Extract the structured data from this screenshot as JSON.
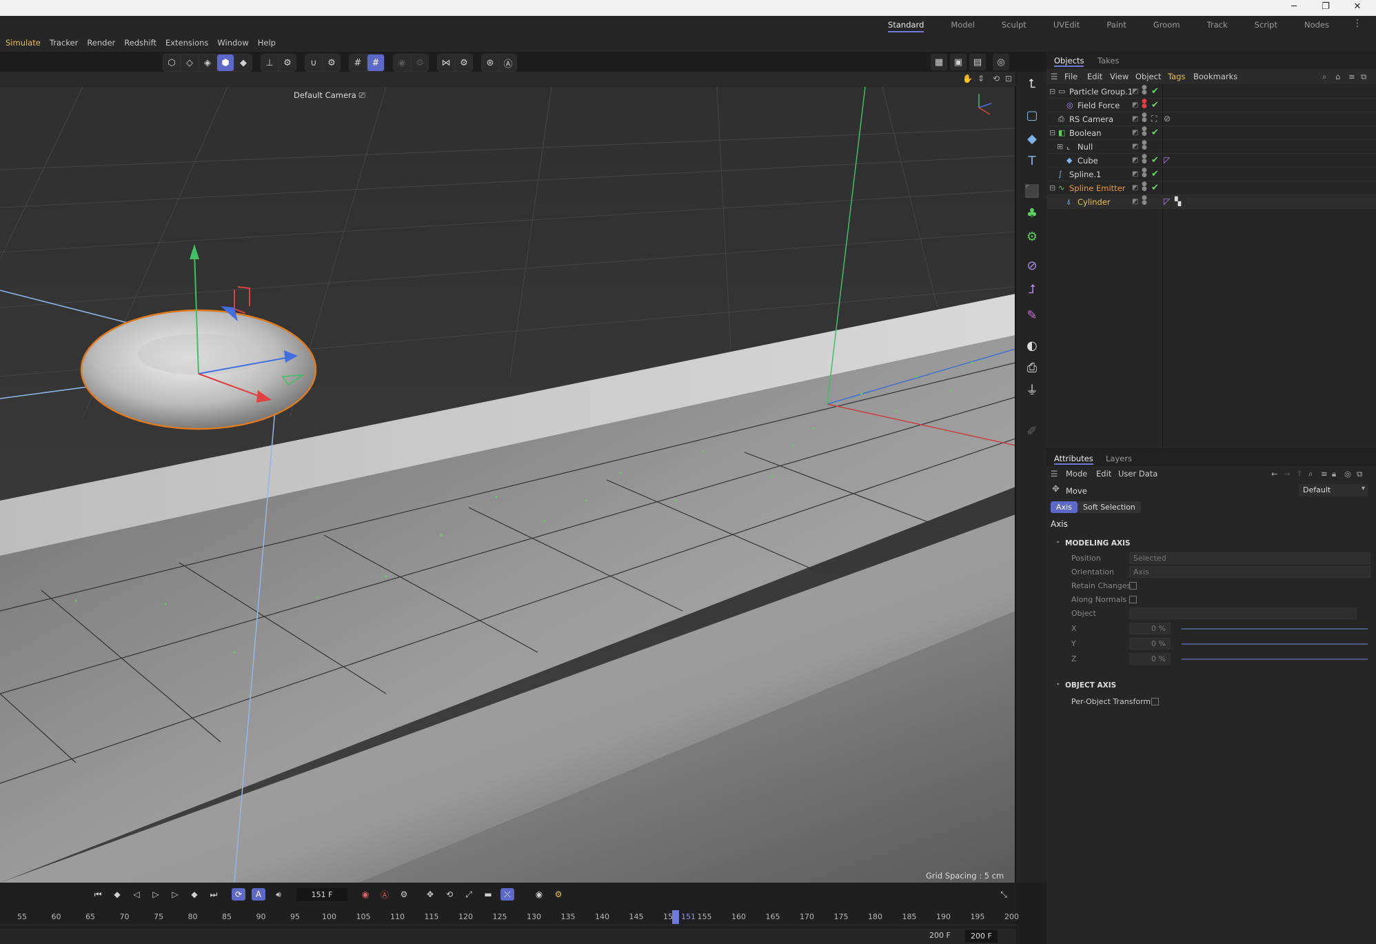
{
  "window": {
    "minimize": "─",
    "restore": "❐",
    "close": "✕"
  },
  "menus": [
    "Simulate",
    "Tracker",
    "Render",
    "Redshift",
    "Extensions",
    "Window",
    "Help"
  ],
  "layouts": [
    "Standard",
    "Model",
    "Sculpt",
    "UVEdit",
    "Paint",
    "Groom",
    "Track",
    "Script",
    "Nodes"
  ],
  "viewport": {
    "camera_label": "Default Camera",
    "grid_info": "Grid Spacing : 5 cm"
  },
  "objects_panel": {
    "tabs": [
      "Objects",
      "Takes"
    ],
    "menu": [
      "File",
      "Edit",
      "View",
      "Object",
      "Tags",
      "Bookmarks"
    ],
    "rows": [
      {
        "name": "Particle Group.1",
        "indent": 0,
        "icon": "folder-icon"
      },
      {
        "name": "Field Force",
        "indent": 1,
        "icon": "field-force-icon"
      },
      {
        "name": "RS Camera",
        "indent": 0,
        "icon": "camera-icon"
      },
      {
        "name": "Boolean",
        "indent": 0,
        "icon": "boolean-icon"
      },
      {
        "name": "Null",
        "indent": 1,
        "icon": "null-icon"
      },
      {
        "name": "Cube",
        "indent": 1,
        "icon": "cube-icon"
      },
      {
        "name": "Spline.1",
        "indent": 0,
        "icon": "spline-icon"
      },
      {
        "name": "Spline Emitter",
        "indent": 0,
        "icon": "emitter-icon"
      },
      {
        "name": "Cylinder",
        "indent": 1,
        "icon": "cylinder-icon"
      }
    ]
  },
  "attributes": {
    "tabs": [
      "Attributes",
      "Layers"
    ],
    "menu": [
      "Mode",
      "Edit",
      "User Data"
    ],
    "tool": "Move",
    "preset": "Default",
    "buttons": [
      "Axis",
      "Soft Selection"
    ],
    "section_title": "Axis",
    "modeling_axis": {
      "title": "MODELING AXIS",
      "position_label": "Position",
      "position_value": "Selected",
      "orientation_label": "Orientation",
      "orientation_value": "Axis",
      "retain_changes": "Retain Changes",
      "along_normals": "Along Normals",
      "object": "Object",
      "x_label": "X",
      "x_value": "0 %",
      "y_label": "Y",
      "y_value": "0 %",
      "z_label": "Z",
      "z_value": "0 %"
    },
    "object_axis": {
      "title": "OBJECT AXIS",
      "per_object": "Per-Object Transform"
    }
  },
  "timeline": {
    "current_frame": "151 F",
    "ticks": [
      "55",
      "60",
      "65",
      "70",
      "75",
      "80",
      "85",
      "90",
      "95",
      "100",
      "105",
      "110",
      "115",
      "120",
      "125",
      "130",
      "135",
      "140",
      "145",
      "150",
      "155",
      "160",
      "165",
      "170",
      "175",
      "180",
      "185",
      "190",
      "195",
      "200"
    ],
    "playhead_label": "151",
    "end_a": "200 F",
    "end_b": "200 F"
  },
  "colors": {
    "accent": "#5e68c9",
    "menu_active": "#e6c14a",
    "selected_object": "#e89a3a"
  }
}
